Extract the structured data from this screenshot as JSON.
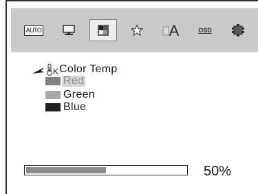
{
  "toolbar": {
    "items": [
      {
        "icon": "auto-icon",
        "label": "AUTO"
      },
      {
        "icon": "monitor-icon"
      },
      {
        "icon": "color-temp-icon",
        "selected": true
      },
      {
        "icon": "star-icon"
      },
      {
        "icon": "font-a-icon",
        "label": "A"
      },
      {
        "icon": "osd-icon",
        "label": "OSD"
      },
      {
        "icon": "reset-icon"
      }
    ]
  },
  "menu": {
    "title": "Color Temp",
    "title_icon": "color-temp-k-icon",
    "title_icon_label": "K",
    "items": [
      {
        "label": "Red",
        "color": "#808080",
        "selected": true
      },
      {
        "label": "Green",
        "color": "#a8a8a8",
        "selected": false
      },
      {
        "label": "Blue",
        "color": "#1e1e1e",
        "selected": false
      }
    ]
  },
  "progress": {
    "value": 0.5,
    "label": "50%"
  }
}
